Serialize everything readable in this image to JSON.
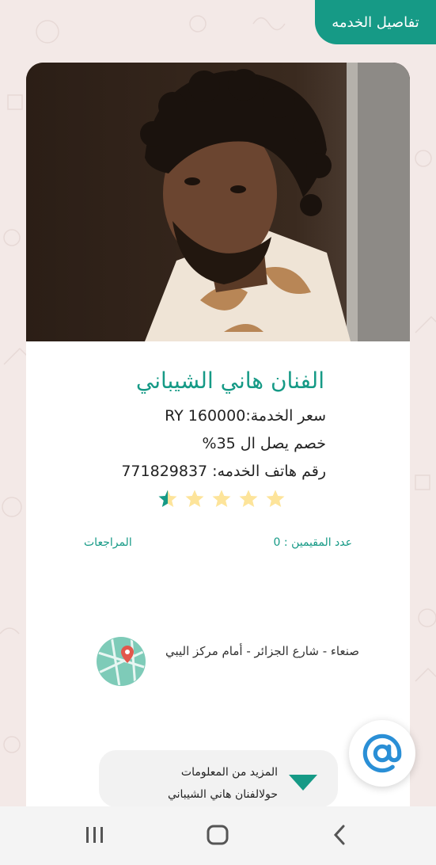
{
  "header": {
    "title": "تفاصيل الخدمه"
  },
  "service": {
    "name": "الفنان هاني الشيباني",
    "price_line": "سعر الخدمة:RY 160000",
    "discount_line": "خصم يصل ال 35%",
    "phone_line": "رقم هاتف الخدمه: 771829837",
    "rating": 0.5,
    "rating_max": 5
  },
  "stats": {
    "reviews_label": "المراجعات",
    "raters_label": "عدد المقيمين : 0"
  },
  "location": {
    "address": "صنعاء - شارع الجزائر - أمام مركز اليبي"
  },
  "more": {
    "line1": "المزيد من المعلومات",
    "line2": "حولالفنان هاني الشيباني"
  },
  "colors": {
    "accent": "#169a86",
    "star_filled": "#169a86",
    "star_empty": "#fde49a",
    "fab_icon": "#2a8fd6"
  },
  "icons": {
    "fab": "at-sign-icon",
    "map": "map-pin-icon",
    "nav_recent": "recent-apps-icon",
    "nav_home": "home-icon",
    "nav_back": "back-icon"
  }
}
